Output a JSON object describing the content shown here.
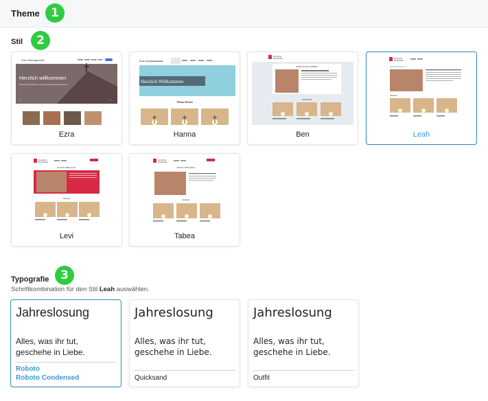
{
  "header": {
    "title": "Theme"
  },
  "badges": [
    "1",
    "2",
    "3"
  ],
  "styles": {
    "title": "Stil",
    "items": [
      {
        "name": "Ezra",
        "selected": false
      },
      {
        "name": "Hanna",
        "selected": false
      },
      {
        "name": "Ben",
        "selected": false
      },
      {
        "name": "Leah",
        "selected": true
      },
      {
        "name": "Levi",
        "selected": false
      },
      {
        "name": "Tabea",
        "selected": false
      }
    ],
    "previews": {
      "ezra": {
        "site": "Evan. Kirchengemeinde",
        "hero": "Herzlich willkommen",
        "hero_sub": "Wir laden Sie herzlich ein, unsere Gemeinde kennenzulernen."
      },
      "hanna": {
        "site": "Evan. Kirchengemeinde",
        "hero": "Herzlich Willkommen",
        "section": "Theme Boxen"
      },
      "ben": {
        "org_line1": "Gemeinde",
        "org_line2": "Musterstadt",
        "welcome": "HERZLICH WILLKOMMEN",
        "section": "AKTUELLES"
      },
      "leah": {
        "org_line1": "Gemeinde",
        "org_line2": "Musterstadt",
        "welcome": "Herzlich willkommen",
        "section": "Aktuelles"
      },
      "levi": {
        "org_line1": "Gemeinde",
        "org_line2": "Musterstadt",
        "welcome": "Herzlich Willkommen",
        "section": "Aktuelles"
      },
      "tabea": {
        "org_line1": "Gemeinde",
        "org_line2": "Musterstadt",
        "welcome": "Herzlich Willkommen",
        "section": "Aktuelles"
      }
    }
  },
  "typography": {
    "title": "Typografie",
    "desc_prefix": "Schriftkombination für den Stil ",
    "desc_style": "Leah",
    "desc_suffix": " auswählen.",
    "sample_heading": "Jahreslosung",
    "sample_line1": "Alles, was ihr tut,",
    "sample_line2": "geschehe in Liebe.",
    "options": [
      {
        "fonts": [
          "Roboto",
          "Roboto Condensed"
        ],
        "selected": true
      },
      {
        "fonts": [
          "Quicksand"
        ],
        "selected": false
      },
      {
        "fonts": [
          "Outfit"
        ],
        "selected": false
      }
    ]
  },
  "colors": {
    "accent": "#3a9ad9",
    "badge": "#2ecc40",
    "brand_red": "#d62a45"
  }
}
